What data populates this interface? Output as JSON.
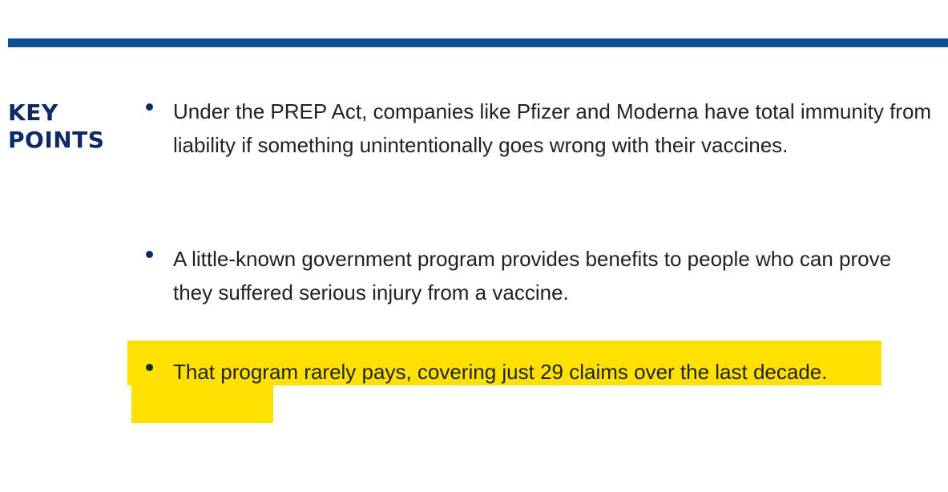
{
  "heading": {
    "line1": "KEY",
    "line2": "POINTS"
  },
  "bullets": [
    {
      "text": "Under the PREP Act, companies like Pfizer and Moderna have total immunity from liability if something unintentionally goes wrong with their vaccines."
    },
    {
      "text": "A little-known government program provides benefits to people who can prove they suffered serious injury from a vaccine."
    },
    {
      "text": "That program rarely pays, covering just 29 claims over the last decade."
    }
  ],
  "colors": {
    "rule": "#0b4f8e",
    "heading": "#0d2a66",
    "highlight": "#ffe100",
    "body_text": "#222222"
  }
}
